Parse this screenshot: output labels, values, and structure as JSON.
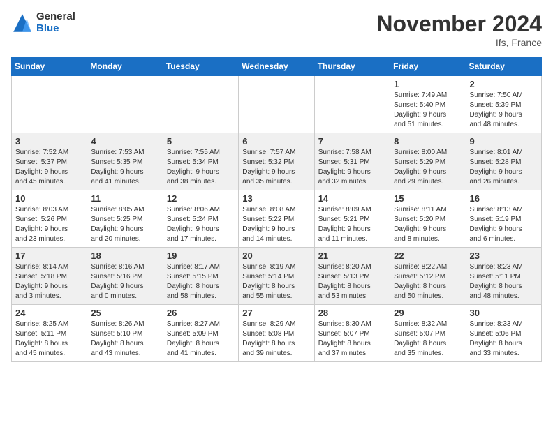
{
  "header": {
    "logo_general": "General",
    "logo_blue": "Blue",
    "month_title": "November 2024",
    "location": "Ifs, France"
  },
  "weekdays": [
    "Sunday",
    "Monday",
    "Tuesday",
    "Wednesday",
    "Thursday",
    "Friday",
    "Saturday"
  ],
  "weeks": [
    [
      {
        "day": "",
        "info": ""
      },
      {
        "day": "",
        "info": ""
      },
      {
        "day": "",
        "info": ""
      },
      {
        "day": "",
        "info": ""
      },
      {
        "day": "",
        "info": ""
      },
      {
        "day": "1",
        "info": "Sunrise: 7:49 AM\nSunset: 5:40 PM\nDaylight: 9 hours\nand 51 minutes."
      },
      {
        "day": "2",
        "info": "Sunrise: 7:50 AM\nSunset: 5:39 PM\nDaylight: 9 hours\nand 48 minutes."
      }
    ],
    [
      {
        "day": "3",
        "info": "Sunrise: 7:52 AM\nSunset: 5:37 PM\nDaylight: 9 hours\nand 45 minutes."
      },
      {
        "day": "4",
        "info": "Sunrise: 7:53 AM\nSunset: 5:35 PM\nDaylight: 9 hours\nand 41 minutes."
      },
      {
        "day": "5",
        "info": "Sunrise: 7:55 AM\nSunset: 5:34 PM\nDaylight: 9 hours\nand 38 minutes."
      },
      {
        "day": "6",
        "info": "Sunrise: 7:57 AM\nSunset: 5:32 PM\nDaylight: 9 hours\nand 35 minutes."
      },
      {
        "day": "7",
        "info": "Sunrise: 7:58 AM\nSunset: 5:31 PM\nDaylight: 9 hours\nand 32 minutes."
      },
      {
        "day": "8",
        "info": "Sunrise: 8:00 AM\nSunset: 5:29 PM\nDaylight: 9 hours\nand 29 minutes."
      },
      {
        "day": "9",
        "info": "Sunrise: 8:01 AM\nSunset: 5:28 PM\nDaylight: 9 hours\nand 26 minutes."
      }
    ],
    [
      {
        "day": "10",
        "info": "Sunrise: 8:03 AM\nSunset: 5:26 PM\nDaylight: 9 hours\nand 23 minutes."
      },
      {
        "day": "11",
        "info": "Sunrise: 8:05 AM\nSunset: 5:25 PM\nDaylight: 9 hours\nand 20 minutes."
      },
      {
        "day": "12",
        "info": "Sunrise: 8:06 AM\nSunset: 5:24 PM\nDaylight: 9 hours\nand 17 minutes."
      },
      {
        "day": "13",
        "info": "Sunrise: 8:08 AM\nSunset: 5:22 PM\nDaylight: 9 hours\nand 14 minutes."
      },
      {
        "day": "14",
        "info": "Sunrise: 8:09 AM\nSunset: 5:21 PM\nDaylight: 9 hours\nand 11 minutes."
      },
      {
        "day": "15",
        "info": "Sunrise: 8:11 AM\nSunset: 5:20 PM\nDaylight: 9 hours\nand 8 minutes."
      },
      {
        "day": "16",
        "info": "Sunrise: 8:13 AM\nSunset: 5:19 PM\nDaylight: 9 hours\nand 6 minutes."
      }
    ],
    [
      {
        "day": "17",
        "info": "Sunrise: 8:14 AM\nSunset: 5:18 PM\nDaylight: 9 hours\nand 3 minutes."
      },
      {
        "day": "18",
        "info": "Sunrise: 8:16 AM\nSunset: 5:16 PM\nDaylight: 9 hours\nand 0 minutes."
      },
      {
        "day": "19",
        "info": "Sunrise: 8:17 AM\nSunset: 5:15 PM\nDaylight: 8 hours\nand 58 minutes."
      },
      {
        "day": "20",
        "info": "Sunrise: 8:19 AM\nSunset: 5:14 PM\nDaylight: 8 hours\nand 55 minutes."
      },
      {
        "day": "21",
        "info": "Sunrise: 8:20 AM\nSunset: 5:13 PM\nDaylight: 8 hours\nand 53 minutes."
      },
      {
        "day": "22",
        "info": "Sunrise: 8:22 AM\nSunset: 5:12 PM\nDaylight: 8 hours\nand 50 minutes."
      },
      {
        "day": "23",
        "info": "Sunrise: 8:23 AM\nSunset: 5:11 PM\nDaylight: 8 hours\nand 48 minutes."
      }
    ],
    [
      {
        "day": "24",
        "info": "Sunrise: 8:25 AM\nSunset: 5:11 PM\nDaylight: 8 hours\nand 45 minutes."
      },
      {
        "day": "25",
        "info": "Sunrise: 8:26 AM\nSunset: 5:10 PM\nDaylight: 8 hours\nand 43 minutes."
      },
      {
        "day": "26",
        "info": "Sunrise: 8:27 AM\nSunset: 5:09 PM\nDaylight: 8 hours\nand 41 minutes."
      },
      {
        "day": "27",
        "info": "Sunrise: 8:29 AM\nSunset: 5:08 PM\nDaylight: 8 hours\nand 39 minutes."
      },
      {
        "day": "28",
        "info": "Sunrise: 8:30 AM\nSunset: 5:07 PM\nDaylight: 8 hours\nand 37 minutes."
      },
      {
        "day": "29",
        "info": "Sunrise: 8:32 AM\nSunset: 5:07 PM\nDaylight: 8 hours\nand 35 minutes."
      },
      {
        "day": "30",
        "info": "Sunrise: 8:33 AM\nSunset: 5:06 PM\nDaylight: 8 hours\nand 33 minutes."
      }
    ]
  ]
}
